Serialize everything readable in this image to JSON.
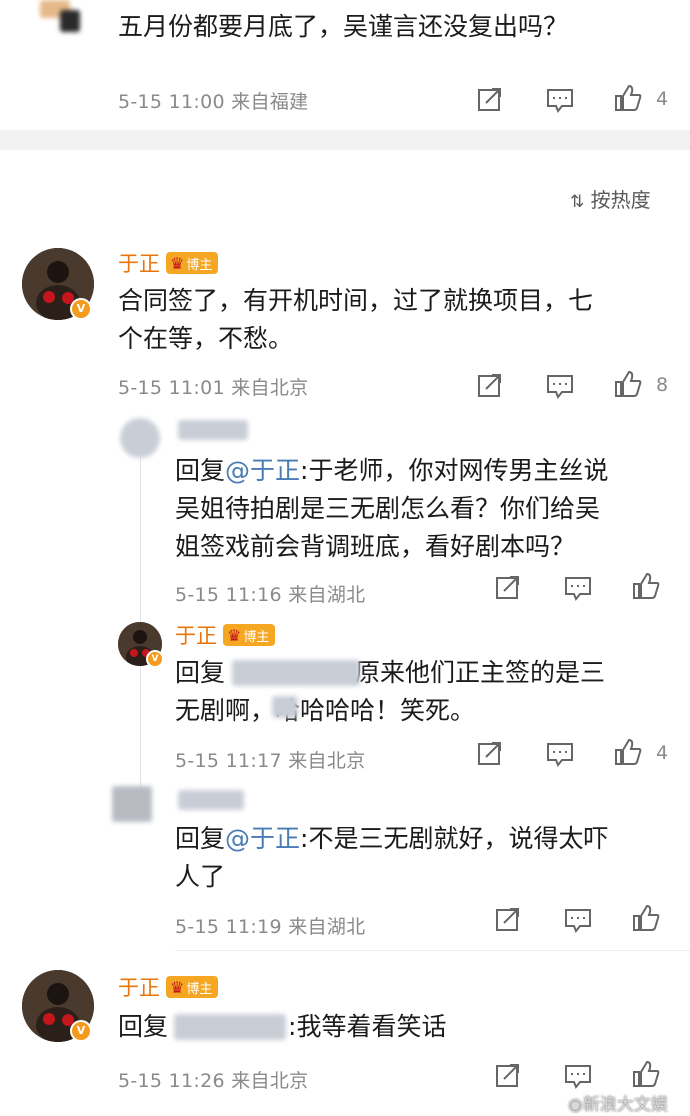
{
  "top_comment": {
    "text": "五月份都要月底了，吴谨言还没复出吗？",
    "meta": "5-15 11:00  来自福建",
    "like_count": "4"
  },
  "sort_label": "按热度",
  "comments": [
    {
      "name": "于正",
      "badge": "博主",
      "text": "合同签了，有开机时间，过了就换项目，七个在等，不愁。",
      "line1": "合同签了，有开机时间，过了就换项目，七",
      "line2": "个在等，不愁。",
      "meta": "5-15 11:01  来自北京",
      "like_count": "8"
    }
  ],
  "replies": [
    {
      "prefix": "回复",
      "mention": "@于正",
      "line1": ":于老师，你对网传男主丝说",
      "line2": "吴姐待拍剧是三无剧怎么看？你们给吴",
      "line3": "姐签戏前会背调班底，看好剧本吗？",
      "meta": "5-15 11:16  来自湖北"
    },
    {
      "name": "于正",
      "badge": "博主",
      "prefix": "回复",
      "line1": "原来他们正主签的是三",
      "line2a": "无剧啊，",
      "line2b": "哈哈哈哈！笑死。",
      "meta": "5-15 11:17  来自北京",
      "like_count": "4"
    },
    {
      "prefix": "回复",
      "mention": "@于正",
      "line1": ":不是三无剧就好，说得太吓",
      "line2": "人了",
      "meta": "5-15 11:19  来自湖北"
    }
  ],
  "last_comment": {
    "name": "于正",
    "badge": "博主",
    "prefix": "回复",
    "text": ":我等着看笑话",
    "meta": "5-15 11:26  来自北京"
  },
  "watermark": "新浪大文娱"
}
